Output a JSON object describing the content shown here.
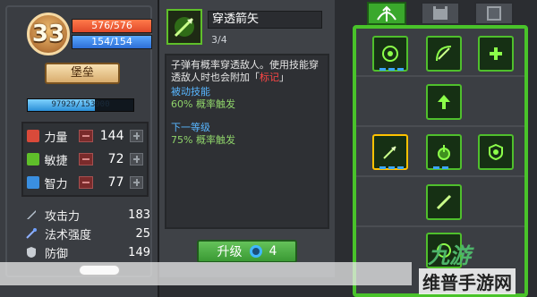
{
  "character": {
    "level": "33",
    "hp": "576/576",
    "mp": "154/154",
    "location_button": "堡垒",
    "xp_text": "97929/153900",
    "xp_fraction": 0.636
  },
  "stats": [
    {
      "label": "力量",
      "value": "144",
      "color": "#d94a3a"
    },
    {
      "label": "敏捷",
      "value": "72",
      "color": "#5fbf2a"
    },
    {
      "label": "智力",
      "value": "77",
      "color": "#3a8fe0"
    }
  ],
  "attributes": [
    {
      "label": "攻击力",
      "value": "183"
    },
    {
      "label": "法术强度",
      "value": "25"
    },
    {
      "label": "防御",
      "value": "149"
    }
  ],
  "skill": {
    "name": "穿透箭矢",
    "level": "3/4",
    "description_part1": "子弹有概率穿透敌人。使用技能穿透敌人时也会附加「",
    "description_highlight": "标记",
    "description_part2": "」",
    "passive_title": "被动技能",
    "passive_value": "60% 概率触发",
    "next_title": "下一等级",
    "next_value": "75% 概率触发",
    "upgrade_label": "升级",
    "upgrade_cost": "4"
  },
  "skill_tree": {
    "tabs": [
      "bow-tab",
      "fortress-tab",
      "book-tab"
    ]
  },
  "watermark": {
    "logo": "九游",
    "text": "维普手游网"
  },
  "colors": {
    "accent_green": "#49c32a",
    "hp_red": "#e0492a",
    "mp_blue": "#2d6fd6",
    "highlight_red": "#ff4646"
  }
}
